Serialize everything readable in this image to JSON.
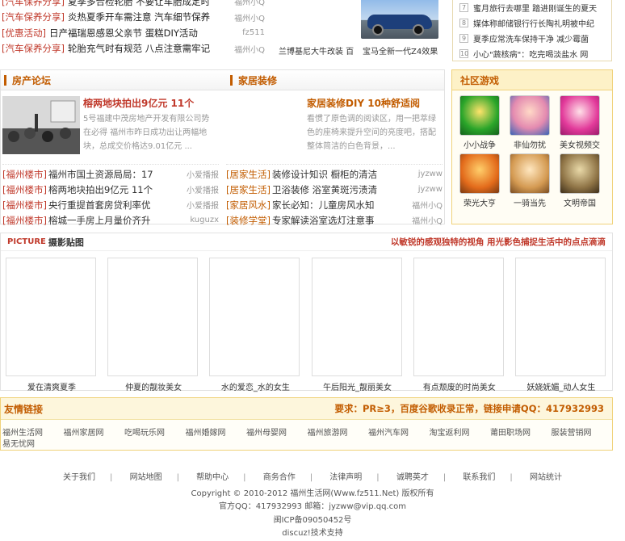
{
  "top_news": [
    {
      "tag": "[汽车保养分享]",
      "title": "夏季多合检轮胎 不要让车胎成定时",
      "author": "福州小Q"
    },
    {
      "tag": "[汽车保养分享]",
      "title": "炎热夏季开车需注意 汽车细节保养",
      "author": "福州小Q"
    },
    {
      "tag": "[优惠活动]",
      "title": "日产福瑞恩感恩父亲节 蛋糕DIY活动",
      "author": "fz511"
    },
    {
      "tag": "[汽车保养分享]",
      "title": "轮胎充气时有规范 八点注意需牢记",
      "author": "福州小Q"
    }
  ],
  "top_pics": {
    "cap1": "兰博基尼大牛改装 百",
    "cap2": "宝马全新一代Z4效果"
  },
  "top_right": [
    {
      "n": "7",
      "t": "蜜月旅行去哪里 踏进刚诞生的夏天"
    },
    {
      "n": "8",
      "t": "媒体称邮储银行行长陶礼明被中纪"
    },
    {
      "n": "9",
      "t": "夏季应常洗车保持干净 减少霉菌"
    },
    {
      "n": "10",
      "t": "小心\"蔬核病\"：吃完喝淡盐水 网"
    }
  ],
  "house": {
    "title": "房产论坛",
    "feature_title": "榕两地块拍出9亿元 11个",
    "feature_desc": "5号福建中茂房地产开发有限公司势在必得 福州市昨日成功出让两幅地块，总成交价格达9.01亿元 ...",
    "items": [
      {
        "tag": "[福州楼市]",
        "title": "福州市国土资源局局：17",
        "author": "小爱播报"
      },
      {
        "tag": "[福州楼市]",
        "title": "榕两地块拍出9亿元 11个",
        "author": "小爱播报"
      },
      {
        "tag": "[福州楼市]",
        "title": "央行重提首套房贷利率优",
        "author": "小爱播报"
      },
      {
        "tag": "[福州楼市]",
        "title": "榕城一手房上月量价齐升",
        "author": "kuguzx"
      }
    ]
  },
  "deco": {
    "title": "家居装修",
    "feature_title": "家居装修DIY 10种舒适阅",
    "feature_desc": "看惯了原色调的阅读区，用一把萃绿色的座椅来提升空间的亮度吧，搭配整体简洁的白色背景，...",
    "items": [
      {
        "tag": "[居家生活]",
        "title": "装修设计知识 橱柜的清洁",
        "author": "jyzww"
      },
      {
        "tag": "[居家生活]",
        "title": "卫浴装修 浴室黄斑污渍清",
        "author": "jyzww"
      },
      {
        "tag": "[家居风水]",
        "title": "家长必知：儿童房风水知",
        "author": "福州小Q"
      },
      {
        "tag": "[装修学堂]",
        "title": "专家解读浴室选灯注意事",
        "author": "福州小Q"
      }
    ]
  },
  "games": {
    "title": "社区游戏",
    "items": [
      {
        "name": "小小战争",
        "icon": "game-icon-war"
      },
      {
        "name": "非仙勿扰",
        "icon": "game-icon-fairy"
      },
      {
        "name": "美女视频交",
        "icon": "game-icon-video"
      },
      {
        "name": "荣光大亨",
        "icon": "game-icon-tycoon"
      },
      {
        "name": "一骑当先",
        "icon": "game-icon-rider"
      },
      {
        "name": "文明帝国",
        "icon": "game-icon-empire"
      }
    ]
  },
  "picture": {
    "label_en": "PICTURE",
    "label_cn": "摄影贴图",
    "slogan": "以敏锐的感观独特的视角 用光影色捕捉生活中的点点滴滴",
    "items": [
      "爱在清爽夏季",
      "仲夏的靓妆美女",
      "水的爱恋_水的女生",
      "午后阳光_靓丽美女",
      "有点颓废的时尚美女",
      "妖娆妩媚_动人女生"
    ]
  },
  "links": {
    "title": "友情链接",
    "requirement": "要求：PR≥3，百度谷歌收录正常，链接申请QQ：417932993",
    "items": [
      "福州生活网",
      "福州家居网",
      "吃喝玩乐网",
      "福州婚嫁网",
      "福州母婴网",
      "福州旅游网",
      "福州汽车网",
      "淘宝返利网",
      "莆田职场网",
      "服装营销网",
      "易无忧网"
    ]
  },
  "footer": {
    "nav": [
      "关于我们",
      "网站地图",
      "帮助中心",
      "商务合作",
      "法律声明",
      "诚聘英才",
      "联系我们",
      "网站统计"
    ],
    "copyright": "Copyright © 2010-2012 福州生活网(Www.fz511.Net) 版权所有",
    "contact": "官方QQ：417932993 邮箱：jyzww@vip.qq.com",
    "icp": "闽ICP备09050452号",
    "support": "discuz!技术支持"
  },
  "colors": {
    "accent": "#c25c00",
    "tag_red": "#c0392b",
    "game_border": "#f0d27a"
  }
}
